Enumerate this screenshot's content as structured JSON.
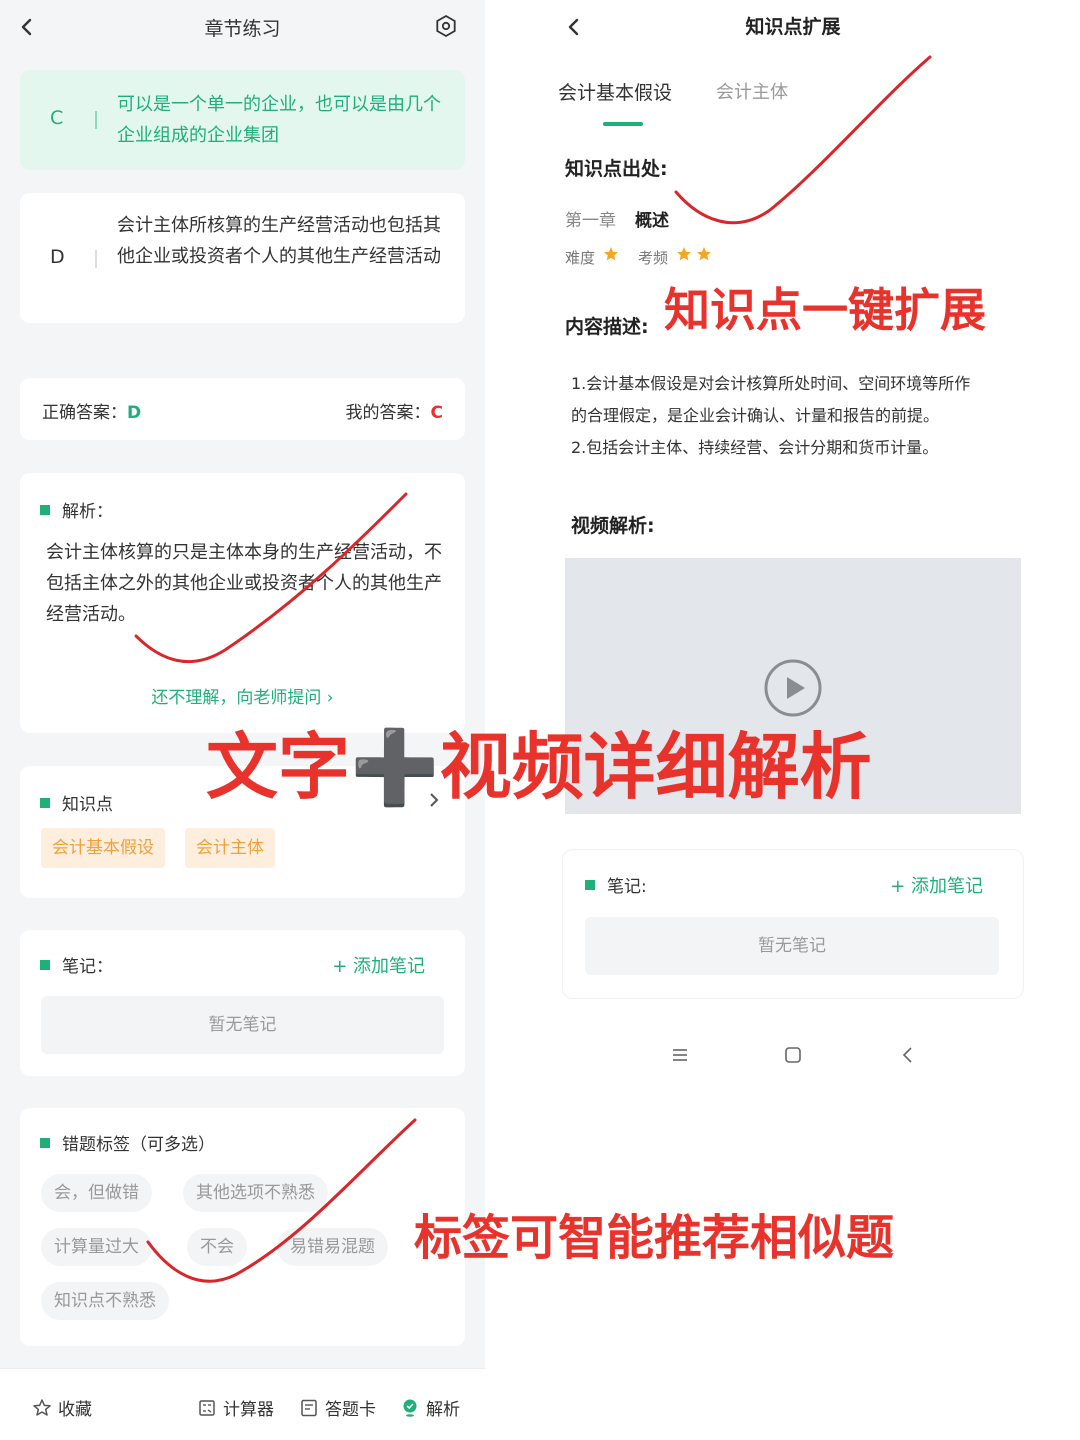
{
  "left": {
    "header": {
      "title": "章节练习"
    },
    "options": [
      {
        "letter": "C",
        "text": "可以是一个单一的企业，也可以是由几个企业组成的企业集团"
      },
      {
        "letter": "D",
        "text": "会计主体所核算的生产经营活动也包括其他企业或投资者个人的其他生产经营活动"
      }
    ],
    "answers": {
      "correct_label": "正确答案：",
      "correct": "D",
      "mine_label": "我的答案：",
      "mine": "C"
    },
    "explain": {
      "title": "解析：",
      "text": "会计主体核算的只是主体本身的生产经营活动，不包括主体之外的其他企业或投资者个人的其他生产经营活动。",
      "ask_link": "还不理解，向老师提问 ›"
    },
    "knowledge": {
      "title": "知识点",
      "tags": [
        "会计基本假设",
        "会计主体"
      ]
    },
    "notes": {
      "title": "笔记：",
      "add": "+ 添加笔记",
      "empty": "暂无笔记"
    },
    "error_tags": {
      "title": "错题标签（可多选）",
      "tags": [
        "会，但做错",
        "其他选项不熟悉",
        "计算量过大",
        "不会",
        "易错易混题",
        "知识点不熟悉"
      ]
    },
    "bottom": {
      "favorite": "收藏",
      "calculator": "计算器",
      "answer_card": "答题卡",
      "analysis": "解析"
    }
  },
  "right": {
    "header": {
      "title": "知识点扩展"
    },
    "tabs": [
      "会计基本假设",
      "会计主体"
    ],
    "source_label": "知识点出处:",
    "chapter": "第一章",
    "chapter_name": "概述",
    "difficulty_label": "难度",
    "frequency_label": "考频",
    "difficulty_stars": 1,
    "frequency_stars": 2,
    "desc_label": "内容描述:",
    "desc_lines": [
      "1.会计基本假设是对会计核算所处时间、空间环境等所作",
      "的合理假定，是企业会计确认、计量和报告的前提。",
      "2.包括会计主体、持续经营、会计分期和货币计量。"
    ],
    "video_label": "视频解析:",
    "notes": {
      "title": "笔记:",
      "add": "+ 添加笔记",
      "empty": "暂无笔记"
    }
  },
  "captions": {
    "top_right": "知识点一键扩展",
    "middle": "文字➕视频详细解析",
    "bottom_right": "标签可智能推荐相似题"
  },
  "colors": {
    "accent": "#1fb07a",
    "wrong": "#e8332c",
    "tag_orange": "#f0a13c",
    "star": "#f5a623"
  }
}
